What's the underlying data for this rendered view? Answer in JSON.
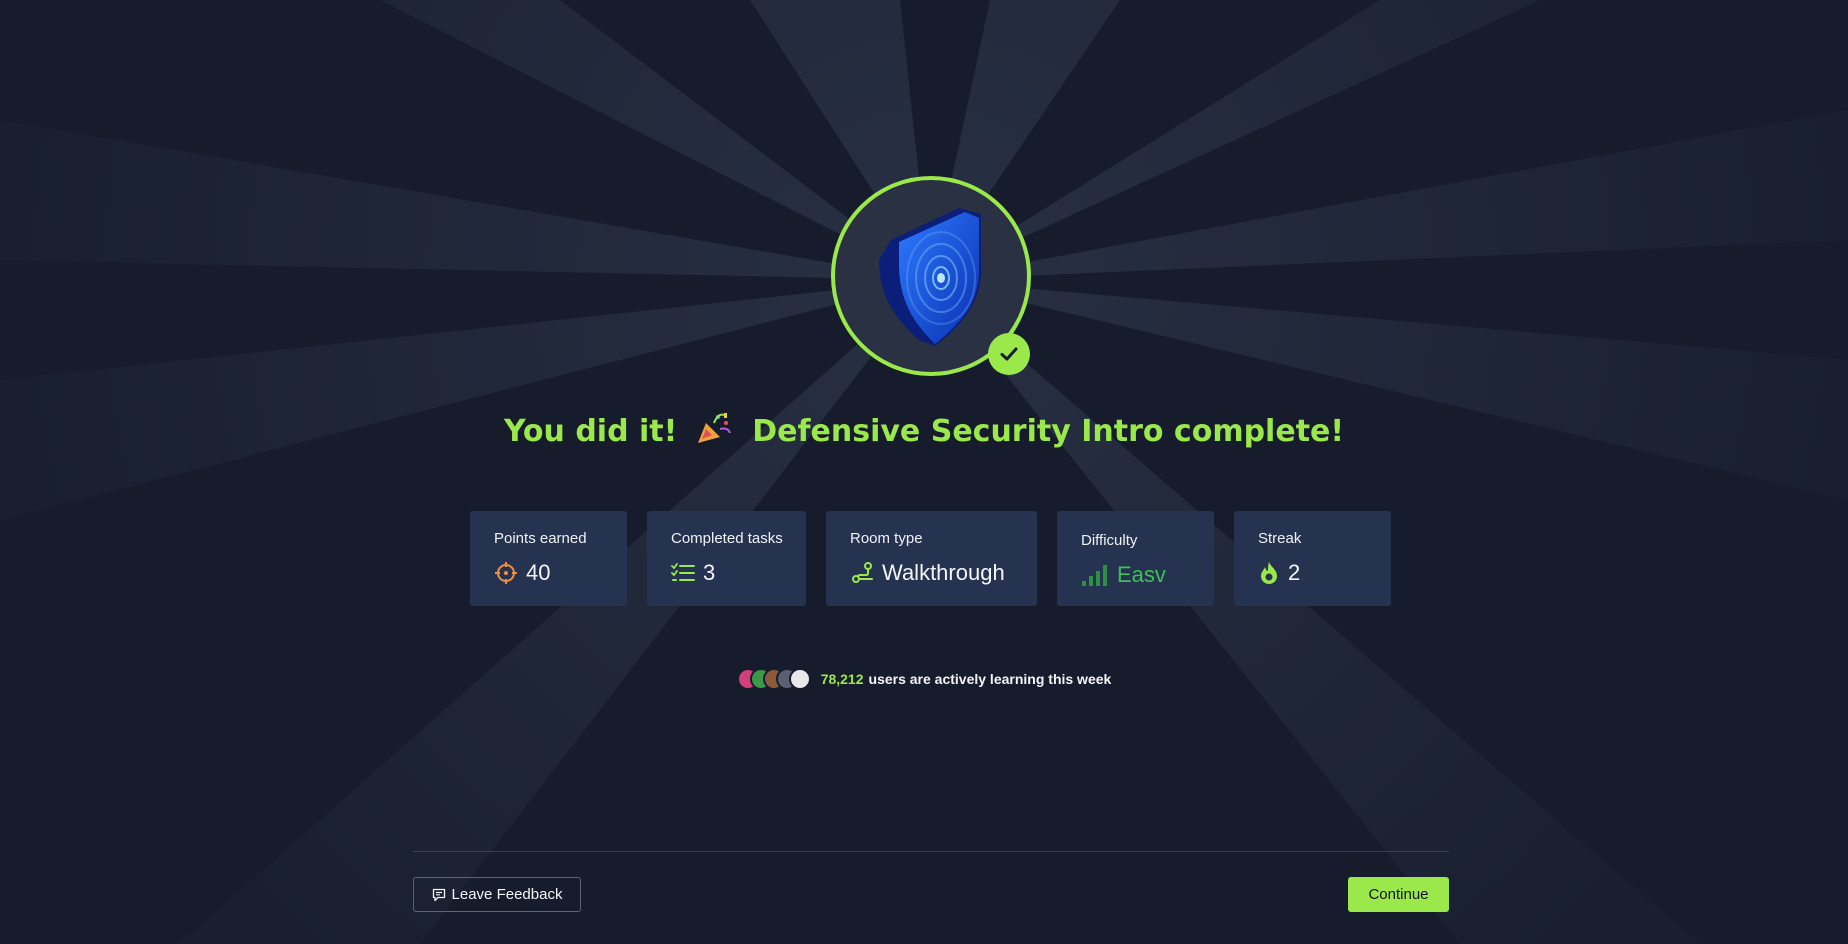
{
  "headline": {
    "prefix": "You did it!",
    "suffix": "Defensive Security Intro complete!",
    "emoji_icon": "party-popper-icon"
  },
  "stats": [
    {
      "label": "Points earned",
      "value": "40",
      "icon": "target-icon"
    },
    {
      "label": "Completed tasks",
      "value": "3",
      "icon": "checklist-icon"
    },
    {
      "label": "Room type",
      "value": "Walkthrough",
      "icon": "route-icon"
    },
    {
      "label": "Difficulty",
      "value": "Easv",
      "icon": "signal-bars-icon"
    },
    {
      "label": "Streak",
      "value": "2",
      "icon": "flame-icon"
    }
  ],
  "community": {
    "count": "78,212",
    "text": "users are actively learning this week"
  },
  "footer": {
    "feedback_label": "Leave Feedback",
    "continue_label": "Continue"
  },
  "colors": {
    "accent": "#9ae84a",
    "background": "#161c2c",
    "card": "#263350",
    "easy": "#3fbf57",
    "points_icon": "#f0913a"
  }
}
